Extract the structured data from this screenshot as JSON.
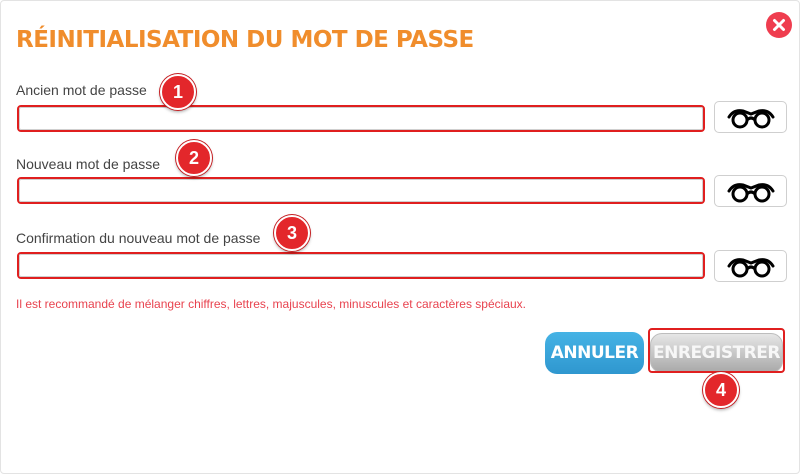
{
  "dialog": {
    "title": "RÉINITIALISATION DU MOT DE PASSE",
    "close_icon": "close-icon"
  },
  "fields": [
    {
      "label": "Ancien mot de passe",
      "value": "",
      "toggle_icon": "glasses-icon"
    },
    {
      "label": "Nouveau mot de passe",
      "value": "",
      "toggle_icon": "glasses-icon"
    },
    {
      "label": "Confirmation du nouveau mot de passe",
      "value": "",
      "toggle_icon": "glasses-icon"
    }
  ],
  "hint": "Il est recommandé de mélanger chiffres, lettres, majuscules, minuscules et caractères spéciaux.",
  "buttons": {
    "cancel_label": "ANNULER",
    "save_label": "ENREGISTRER"
  },
  "markers": [
    "1",
    "2",
    "3",
    "4"
  ],
  "colors": {
    "title": "#f08d2c",
    "close": "#ef3d4f",
    "highlight": "#e01f1f",
    "hint": "#e8434f",
    "cancel": "#3aa6db",
    "save": "#bdbdbd",
    "marker": "#e3272b"
  }
}
